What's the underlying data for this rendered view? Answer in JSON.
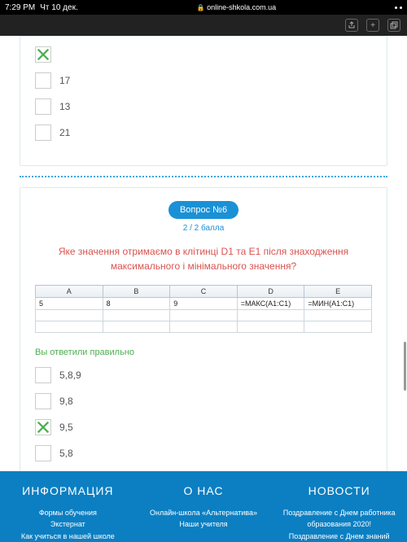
{
  "status": {
    "time": "7:29 PM",
    "date": "Чт 10 дек.",
    "url": "online-shkola.com.ua"
  },
  "q5_options": [
    {
      "label": "",
      "checked": true
    },
    {
      "label": "17",
      "checked": false
    },
    {
      "label": "13",
      "checked": false
    },
    {
      "label": "21",
      "checked": false
    }
  ],
  "q6": {
    "badge": "Вопрос №6",
    "score": "2 / 2 балла",
    "text": "Яке значення отримаємо в клітинці D1  та E1 після знаходження максимального і мінімального значення?",
    "headers": [
      "A",
      "B",
      "C",
      "D",
      "E"
    ],
    "row": [
      "5",
      "8",
      "9",
      "=МАКС(A1:C1)",
      "=МИН(A1:C1)"
    ],
    "status": "Вы ответили правильно",
    "options": [
      {
        "label": "5,8,9",
        "checked": false
      },
      {
        "label": "9,8",
        "checked": false
      },
      {
        "label": "9,5",
        "checked": true
      },
      {
        "label": "5,8",
        "checked": false
      }
    ]
  },
  "footer": {
    "col1": {
      "title": "ИНФОРМАЦИЯ",
      "links": [
        "Формы обучения",
        "Экстернат",
        "Как учиться в нашей школе"
      ]
    },
    "col2": {
      "title": "О НАС",
      "links": [
        "Онлайн-школа «Альтернатива»",
        "Наши учителя"
      ]
    },
    "col3": {
      "title": "НОВОСТИ",
      "links": [
        "Поздравление с Днем работника образования 2020!",
        "Поздравление с Днем знаний"
      ]
    }
  }
}
